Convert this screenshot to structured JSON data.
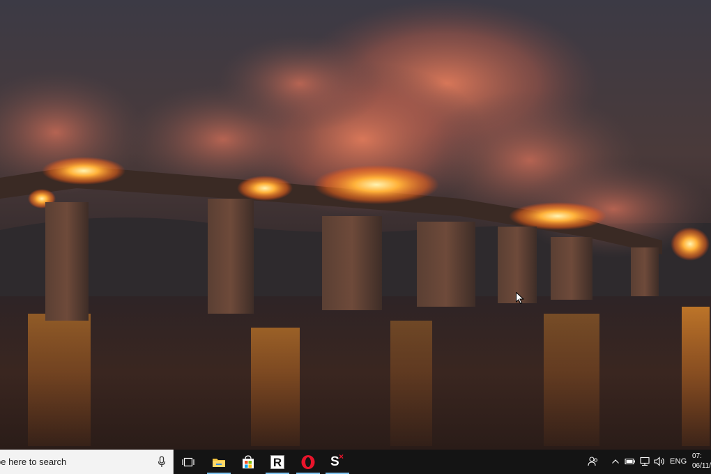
{
  "desktop": {
    "wallpaper_description": "",
    "cursor_icon": "arrow-cursor-icon"
  },
  "taskbar": {
    "search_text": "be here to search",
    "search_full_placeholder": "Type here to search",
    "apps": [
      {
        "name": "Task View",
        "icon": "task-view-icon"
      },
      {
        "name": "File Explorer",
        "icon": "folder-icon",
        "running": true
      },
      {
        "name": "Microsoft Store",
        "icon": "store-bag-icon"
      },
      {
        "name": "R",
        "label": "R",
        "icon": "r-app-icon",
        "running": true
      },
      {
        "name": "Opera",
        "icon": "opera-icon",
        "running": true
      },
      {
        "name": "S",
        "label": "S",
        "superscript": "×",
        "icon": "sx-app-icon",
        "running": true
      }
    ],
    "tray": {
      "language": "ENG",
      "time": "07:",
      "date": "06/11/"
    },
    "colors": {
      "taskbar_bg": "#141414",
      "search_bg": "#f3f3f3",
      "running_indicator": "#7ec3ef"
    }
  }
}
